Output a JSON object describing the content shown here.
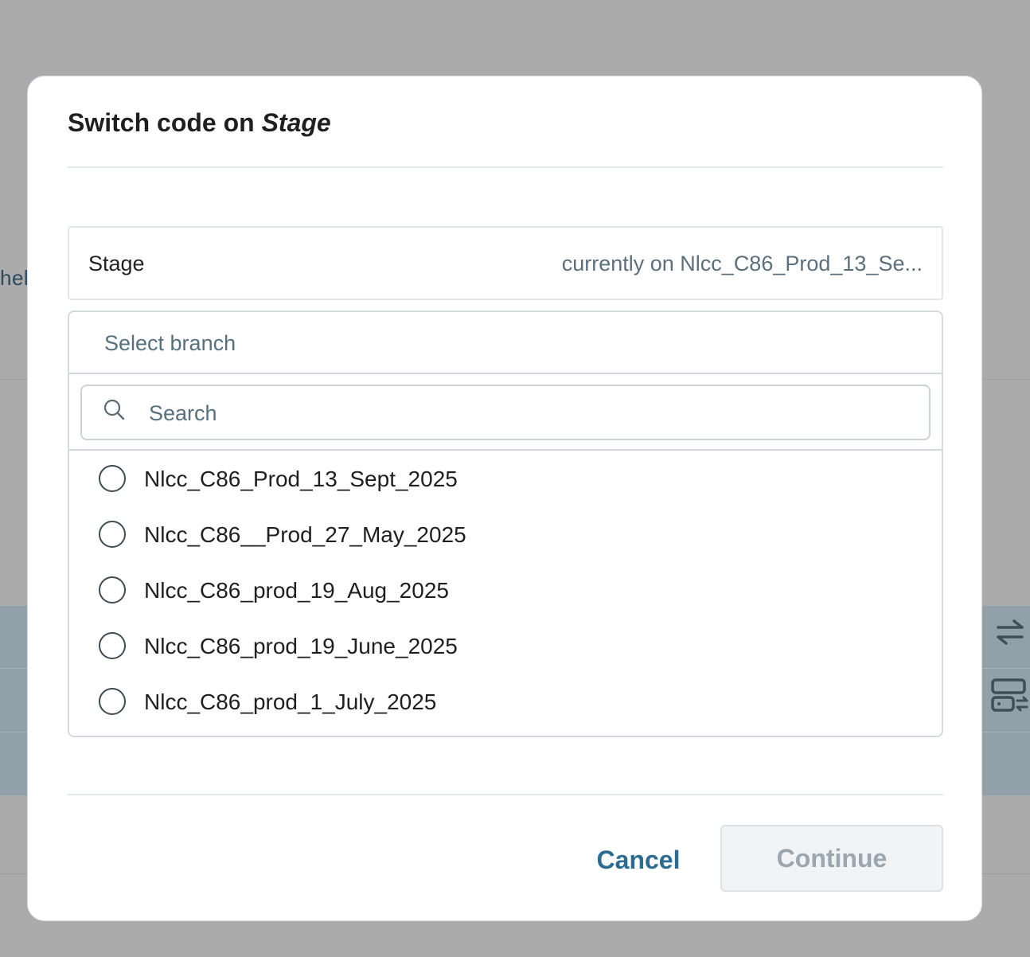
{
  "background": {
    "partial_text": "hel"
  },
  "modal": {
    "title_prefix": "Switch code on ",
    "title_env": "Stage",
    "environment": {
      "name": "Stage",
      "current": "currently on Nlcc_C86_Prod_13_Se..."
    },
    "branch_select": {
      "placeholder": "Select branch"
    },
    "search": {
      "placeholder": "Search",
      "value": ""
    },
    "branches": [
      {
        "label": "Nlcc_C86_Prod_13_Sept_2025",
        "selected": false
      },
      {
        "label": "Nlcc_C86__Prod_27_May_2025",
        "selected": false
      },
      {
        "label": "Nlcc_C86_prod_19_Aug_2025",
        "selected": false
      },
      {
        "label": "Nlcc_C86_prod_19_June_2025",
        "selected": false
      },
      {
        "label": "Nlcc_C86_prod_1_July_2025",
        "selected": false
      }
    ],
    "footer": {
      "cancel_label": "Cancel",
      "continue_label": "Continue"
    }
  },
  "colors": {
    "accent": "#2b6c90",
    "overlay": "#ababab",
    "disabled_text": "#9aa7b0"
  },
  "icons": [
    "search-icon",
    "swap-arrows-icon",
    "server-sync-icon"
  ]
}
